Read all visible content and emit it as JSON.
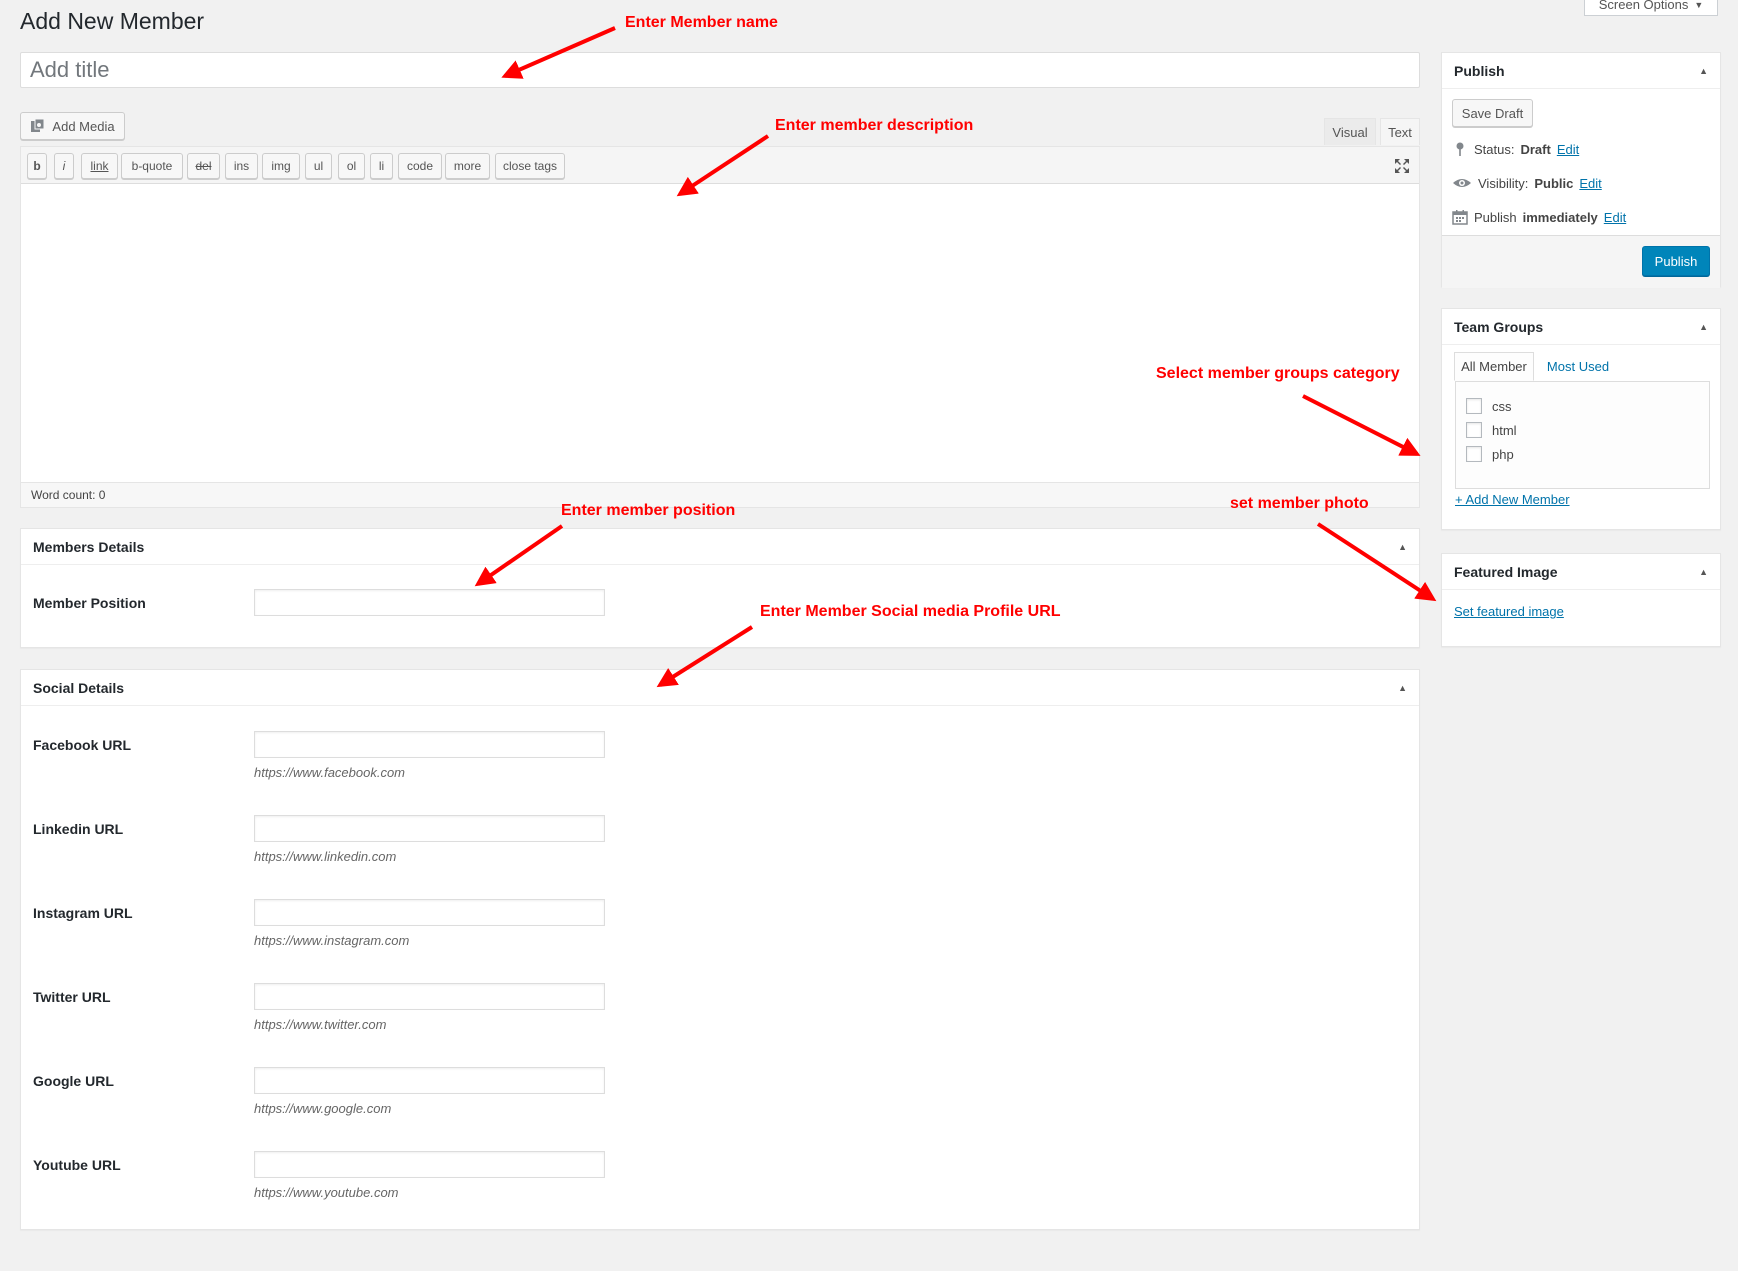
{
  "page": {
    "title": "Add New Member",
    "screen_options": "Screen Options",
    "title_placeholder": "Add title"
  },
  "editor": {
    "add_media": "Add Media",
    "tabs": {
      "visual": "Visual",
      "text": "Text"
    },
    "quicktags": [
      "b",
      "i",
      "link",
      "b-quote",
      "del",
      "ins",
      "img",
      "ul",
      "ol",
      "li",
      "code",
      "more",
      "close tags"
    ],
    "word_count": "Word count: 0"
  },
  "members_details": {
    "heading": "Members Details",
    "position_label": "Member Position"
  },
  "social_details": {
    "heading": "Social Details",
    "fields": [
      {
        "label": "Facebook URL",
        "hint": "https://www.facebook.com"
      },
      {
        "label": "Linkedin URL",
        "hint": "https://www.linkedin.com"
      },
      {
        "label": "Instagram URL",
        "hint": "https://www.instagram.com"
      },
      {
        "label": "Twitter URL",
        "hint": "https://www.twitter.com"
      },
      {
        "label": "Google URL",
        "hint": "https://www.google.com"
      },
      {
        "label": "Youtube URL",
        "hint": "https://www.youtube.com"
      }
    ]
  },
  "publish_box": {
    "heading": "Publish",
    "save_draft": "Save Draft",
    "status_label": "Status:",
    "status_value": "Draft",
    "visibility_label": "Visibility:",
    "visibility_value": "Public",
    "schedule_label": "Publish",
    "schedule_value": "immediately",
    "edit": "Edit",
    "publish": "Publish"
  },
  "team_groups": {
    "heading": "Team Groups",
    "tabs": {
      "all": "All Member",
      "most_used": "Most Used"
    },
    "categories": [
      "css",
      "html",
      "php"
    ],
    "add_new": "+ Add New Member"
  },
  "featured_image": {
    "heading": "Featured Image",
    "set_link": "Set featured image"
  },
  "annotations": {
    "name": "Enter Member name",
    "description": "Enter member description",
    "groups": "Select member groups category",
    "position": "Enter member position",
    "photo": "set member photo",
    "social": "Enter Member Social media Profile URL"
  },
  "colors": {
    "annotation": "#ff0000",
    "primary_button": "#0085ba",
    "link": "#0073aa",
    "background": "#f1f1f1"
  },
  "icons": {
    "add_media": "media-icon",
    "status": "pin-icon",
    "visibility": "eye-icon",
    "schedule": "calendar-icon",
    "fullscreen": "fullscreen-icon",
    "toggle": "triangle-up-icon"
  }
}
